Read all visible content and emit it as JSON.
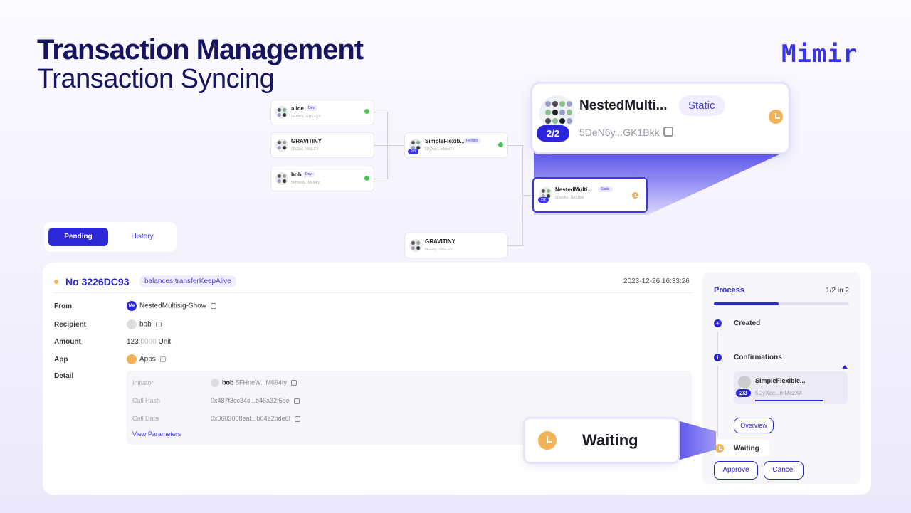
{
  "header": {
    "title": "Transaction Management",
    "subtitle": "Transaction Syncing",
    "logo": "Mimir"
  },
  "tree": {
    "alice": {
      "name": "alice",
      "tag": "Dev",
      "addr": "5Grwva...EHuXQY"
    },
    "gravitiny1": {
      "name": "GRAVITINY",
      "addr": "5FGSq...VkSLEV"
    },
    "bob": {
      "name": "bob",
      "tag": "Dev",
      "addr": "5FHneW...M694ty"
    },
    "simple": {
      "name": "SimpleFlexib...",
      "tag": "Flexible",
      "threshold": "2/3",
      "addr": "5DyXoc...mMczX4"
    },
    "nested": {
      "name": "NestedMulti...",
      "tag": "Static",
      "threshold": "2/2",
      "addr": "5DeN6y...GK1Bkk"
    },
    "gravitiny2": {
      "name": "GRAVITINY",
      "addr": "5FGSq...VkSLEV"
    }
  },
  "zoom": {
    "name": "NestedMulti...",
    "tag": "Static",
    "threshold": "2/2",
    "addr": "5DeN6y...GK1Bkk"
  },
  "tabs": {
    "pending": "Pending",
    "history": "History"
  },
  "tx": {
    "id": "No 3226DC93",
    "method": "balances.transferKeepAlive",
    "date": "2023-12-26 16:33:26",
    "labels": {
      "from": "From",
      "recipient": "Recipient",
      "amount": "Amount",
      "app": "App",
      "detail": "Detail"
    },
    "from": "NestedMultisig-Show",
    "from_avatar": "Me",
    "recipient": "bob",
    "amount_int": "123",
    "amount_dec": ".0000",
    "amount_unit": "Unit",
    "app": "Apps",
    "detail": {
      "initiator_label": "Initiator",
      "initiator_name": "bob",
      "initiator_addr": "5FHneW...M694ty",
      "callhash_label": "Call Hash",
      "callhash": "0x487f3cc34c...b46a32f5de",
      "calldata_label": "Call Data",
      "calldata": "0x0603008eaf...b04e2bde6f",
      "view_params": "View Parameters"
    }
  },
  "process": {
    "title": "Process",
    "count": "1/2 in 2",
    "created": "Created",
    "confirmations": "Confirmations",
    "member_name": "SimpleFlexible...",
    "member_threshold": "2/3",
    "member_addr": "5DyXoc...mMczX4",
    "overview": "Overview",
    "waiting": "Waiting",
    "approve": "Approve",
    "cancel": "Cancel"
  },
  "callout": {
    "waiting": "Waiting"
  },
  "colors": {
    "accent": "#2b26d9",
    "pending": "#f2b257",
    "ok": "#4fc15a"
  }
}
